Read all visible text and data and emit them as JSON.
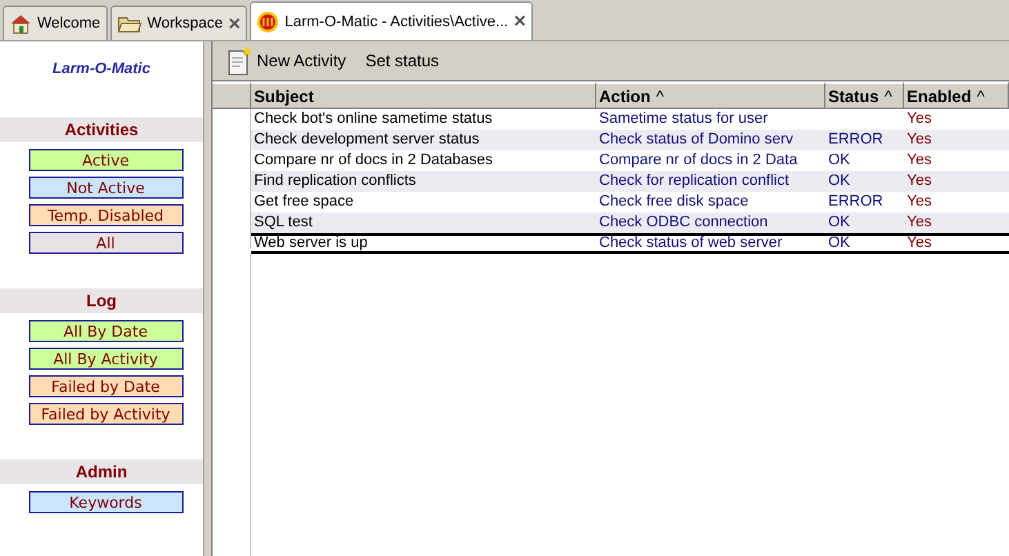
{
  "tabs": [
    {
      "label": "Welcome",
      "selected": false
    },
    {
      "label": "Workspace",
      "close": "×",
      "selected": false
    },
    {
      "label": "Larm-O-Matic - Activities\\Active...",
      "close": "×",
      "selected": true
    }
  ],
  "sidebar": {
    "title": "Larm-O-Matic",
    "sections": [
      {
        "heading": "Activities",
        "items": [
          {
            "label": "Active",
            "color": "#ccff99"
          },
          {
            "label": "Not Active",
            "color": "#cce5ff"
          },
          {
            "label": "Temp. Disabled",
            "color": "#ffdcb4"
          },
          {
            "label": "All",
            "color": "#e6e2e6"
          }
        ]
      },
      {
        "heading": "Log",
        "items": [
          {
            "label": "All By Date",
            "color": "#ccff99"
          },
          {
            "label": "All By Activity",
            "color": "#ccff99"
          },
          {
            "label": "Failed by Date",
            "color": "#ffdcb4"
          },
          {
            "label": "Failed by Activity",
            "color": "#ffdcb4"
          }
        ]
      },
      {
        "heading": "Admin",
        "items": [
          {
            "label": "Keywords",
            "color": "#cce5ff"
          }
        ]
      }
    ]
  },
  "toolbar": {
    "buttons": [
      {
        "label": "New Activity",
        "kind": "new"
      },
      {
        "label": "Set status",
        "kind": "plain"
      }
    ]
  },
  "table": {
    "columns": [
      {
        "label": "Subject"
      },
      {
        "label": "Action",
        "sort": "^"
      },
      {
        "label": "Status",
        "sort": "^"
      },
      {
        "label": "Enabled",
        "sort": "^"
      }
    ],
    "rows": [
      {
        "subject": "Check bot's online sametime status",
        "action": "Sametime status for user",
        "enabled": "Yes",
        "selected": false
      },
      {
        "subject": "Check development server status",
        "action": "Check status of Domino serv",
        "status": "ERROR",
        "enabled": "Yes",
        "selected": false
      },
      {
        "subject": "Compare nr of docs in 2 Databases",
        "action": "Compare nr of docs in 2 Data",
        "status": "OK",
        "enabled": "Yes",
        "selected": false
      },
      {
        "subject": "Find replication conflicts",
        "action": "Check for replication conflict",
        "status": "OK",
        "enabled": "Yes",
        "selected": false
      },
      {
        "subject": "Get free space",
        "action": "Check free disk space",
        "status": "ERROR",
        "enabled": "Yes",
        "selected": false
      },
      {
        "subject": "SQL test",
        "action": "Check ODBC connection",
        "status": "OK",
        "enabled": "Yes",
        "selected": false
      },
      {
        "subject": "Web server is up",
        "action": "Check status of web server",
        "status": "OK",
        "enabled": "Yes",
        "selected": true
      }
    ]
  }
}
